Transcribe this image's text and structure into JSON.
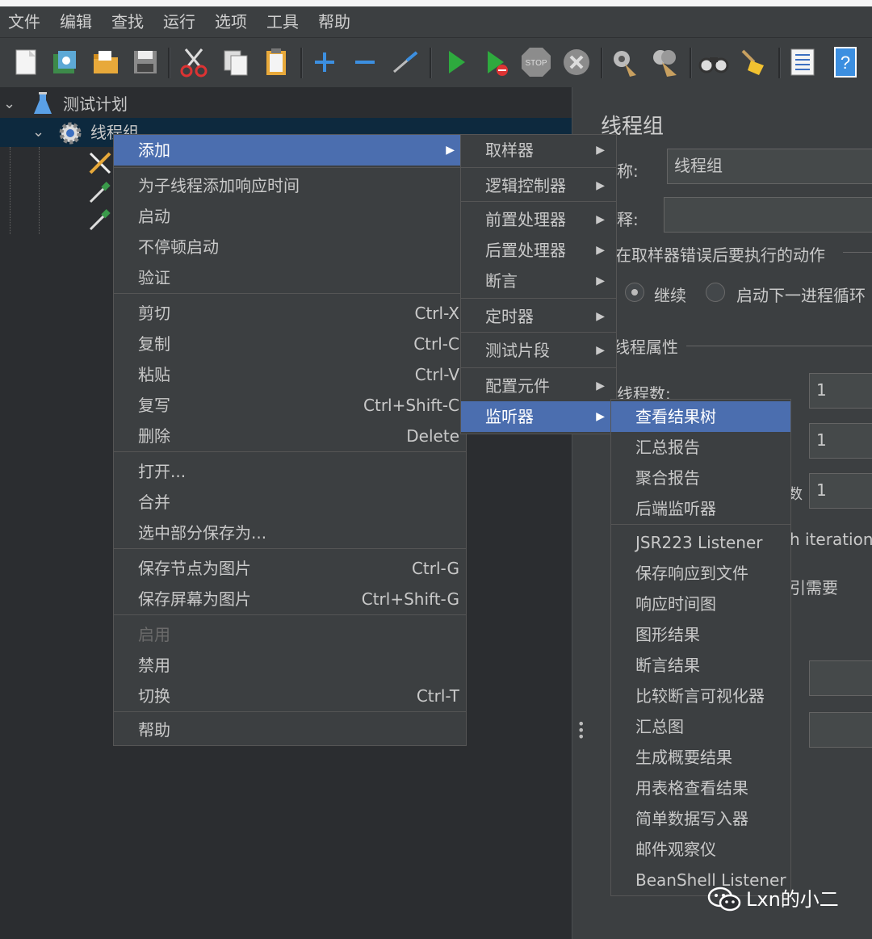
{
  "menubar": [
    "文件",
    "编辑",
    "查找",
    "运行",
    "选项",
    "工具",
    "帮助"
  ],
  "toolbar": {
    "icons": [
      "new-icon",
      "templates-icon",
      "open-icon",
      "save-icon",
      "cut-icon",
      "copy-icon",
      "paste-icon",
      "expand-icon",
      "collapse-icon",
      "toggle-icon",
      "start-icon",
      "start-no-pauses-icon",
      "stop-icon",
      "shutdown-icon",
      "clear-icon",
      "clear-all-icon",
      "search-icon",
      "reset-search-icon",
      "function-helper-icon",
      "help-icon"
    ]
  },
  "tree": {
    "root": "测试计划",
    "thread_group": "线程组"
  },
  "context_menu": {
    "items": [
      {
        "label": "添加",
        "shortcut": "",
        "submenu": true,
        "highlight": true
      },
      {
        "label": "为子线程添加响应时间",
        "shortcut": ""
      },
      {
        "label": "启动",
        "shortcut": ""
      },
      {
        "label": "不停顿启动",
        "shortcut": ""
      },
      {
        "label": "验证",
        "shortcut": ""
      },
      {
        "label": "剪切",
        "shortcut": "Ctrl-X"
      },
      {
        "label": "复制",
        "shortcut": "Ctrl-C"
      },
      {
        "label": "粘贴",
        "shortcut": "Ctrl-V"
      },
      {
        "label": "复写",
        "shortcut": "Ctrl+Shift-C"
      },
      {
        "label": "删除",
        "shortcut": "Delete"
      },
      {
        "label": "打开...",
        "shortcut": ""
      },
      {
        "label": "合并",
        "shortcut": ""
      },
      {
        "label": "选中部分保存为...",
        "shortcut": ""
      },
      {
        "label": "保存节点为图片",
        "shortcut": "Ctrl-G"
      },
      {
        "label": "保存屏幕为图片",
        "shortcut": "Ctrl+Shift-G"
      },
      {
        "label": "启用",
        "shortcut": "",
        "disabled": true
      },
      {
        "label": "禁用",
        "shortcut": ""
      },
      {
        "label": "切换",
        "shortcut": "Ctrl-T"
      },
      {
        "label": "帮助",
        "shortcut": ""
      }
    ]
  },
  "add_submenu": [
    "取样器",
    "逻辑控制器",
    "前置处理器",
    "后置处理器",
    "断言",
    "定时器",
    "测试片段",
    "配置元件",
    "监听器"
  ],
  "listener_submenu": [
    "查看结果树",
    "汇总报告",
    "聚合报告",
    "后端监听器",
    "JSR223 Listener",
    "保存响应到文件",
    "响应时间图",
    "图形结果",
    "断言结果",
    "比较断言可视化器",
    "汇总图",
    "生成概要结果",
    "用表格查看结果",
    "简单数据写入器",
    "邮件观察仪",
    "BeanShell Listener"
  ],
  "right_panel": {
    "title": "线程组",
    "name_label": "称:",
    "name_value": "线程组",
    "comment_label": "释:",
    "sampler_error_label": "在取样器错误后要执行的动作",
    "radio_continue": "继续",
    "radio_next_loop": "启动下一进程循环",
    "thread_props_label": "线程属性",
    "threads_label": "线程数:",
    "threads_value": "1",
    "ramp_value": "1",
    "loop_value": "1",
    "loop_label_fragment": "数",
    "iteration_text": "h iteration",
    "need_text": "引需要"
  },
  "watermark": "Lxn的小二",
  "colors": {
    "highlight": "#4b6eaf",
    "menu_bg": "#3c3f41",
    "pane_bg": "#2b2d30"
  }
}
